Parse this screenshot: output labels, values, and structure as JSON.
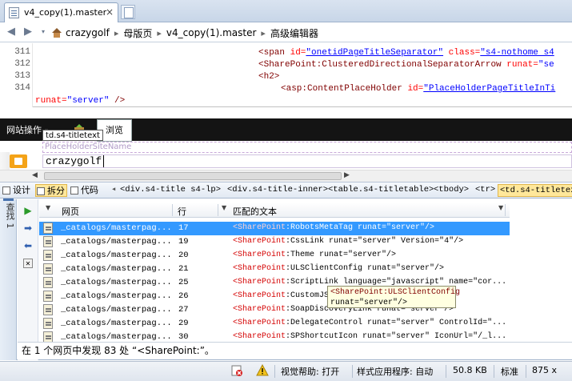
{
  "tab": {
    "label": "v4_copy(1).master",
    "close": "×"
  },
  "breadcrumb": {
    "items": [
      "crazygolf",
      "母版页",
      "v4_copy(1).master",
      "高级编辑器"
    ],
    "sep": "▸"
  },
  "code": {
    "line_numbers": [
      "311",
      "312",
      "313",
      "314"
    ],
    "lines": [
      [
        {
          "c": "tg",
          "t": "<span "
        },
        {
          "c": "at",
          "t": "id="
        },
        {
          "c": "vl",
          "t": "\"onetidPageTitleSeparator\""
        },
        {
          "c": "at",
          "t": " class="
        },
        {
          "c": "vl",
          "t": "\"s4-nothome s4"
        }
      ],
      [
        {
          "c": "tg",
          "t": "<SharePoint:ClusteredDirectionalSeparatorArrow "
        },
        {
          "c": "at",
          "t": "runat="
        },
        {
          "c": "pl",
          "t": "\"se"
        }
      ],
      [
        {
          "c": "tg",
          "t": "<h2>"
        }
      ],
      [
        {
          "c": "tg",
          "t": "<asp:ContentPlaceHolder "
        },
        {
          "c": "at",
          "t": "id="
        },
        {
          "c": "vl",
          "t": "\"PlaceHolderPageTitleInTi"
        }
      ],
      [
        {
          "c": "at",
          "t": "runat="
        },
        {
          "c": "pl",
          "t": "\"server\" "
        },
        {
          "c": "tg",
          "t": "/>"
        }
      ]
    ]
  },
  "design": {
    "site_actions": "网站操作",
    "browse": "浏览",
    "tag_tooltip": "td.s4-titletext",
    "placeholder_label": "PlaceHolderSiteName",
    "site_title": "crazygolf"
  },
  "viewbar": {
    "design": "设计",
    "split": "拆分",
    "code": "代码",
    "tags": [
      "<div.s4-title s4-lp>",
      "<div.s4-title-inner>",
      "<table.s4-titletable>",
      "<tbody>",
      "<tr>",
      "<td.s4-titletext"
    ]
  },
  "find": {
    "side_tab": "查找 1",
    "columns": [
      "网页",
      "行",
      "匹配的文本"
    ],
    "rows": [
      {
        "page": "_catalogs/masterpag...",
        "line": "17",
        "text": "RobotsMetaTag runat=\"server\"/>"
      },
      {
        "page": "_catalogs/masterpag...",
        "line": "19",
        "text": "CssLink runat=\"server\" Version=\"4\"/>"
      },
      {
        "page": "_catalogs/masterpag...",
        "line": "20",
        "text": "Theme runat=\"server\"/>"
      },
      {
        "page": "_catalogs/masterpag...",
        "line": "21",
        "text": "ULSClientConfig runat=\"server\"/>"
      },
      {
        "page": "_catalogs/masterpag...",
        "line": "25",
        "text": "ScriptLink language=\"javascript\" name=\"cor..."
      },
      {
        "page": "_catalogs/masterpag...",
        "line": "26",
        "text": "CustomJS"
      },
      {
        "page": "_catalogs/masterpag...",
        "line": "27",
        "text": "SoapDiscoveryLink runat=\"server\"/>"
      },
      {
        "page": "_catalogs/masterpag...",
        "line": "29",
        "text": "DelegateControl runat=\"server\" ControlId=\"..."
      },
      {
        "page": "_catalogs/masterpag...",
        "line": "30",
        "text": "SPShortcutIcon runat=\"server\" IconUrl=\"/_l..."
      }
    ],
    "match_prefix": "<SharePoint",
    "match_colon": ":",
    "tooltip_line1": "<SharePoint:ULSClientConfig",
    "tooltip_line2": "runat=\"server\"/>",
    "summary": "在 1 个网页中发现 83 处 “<SharePoint:”。"
  },
  "status": {
    "visual_help": "视觉帮助: 打开",
    "style_app": "样式应用程序: 自动",
    "size": "50.8 KB",
    "mode": "标准",
    "dimensions": "875 x"
  },
  "colors": {
    "selection": "#3399ff",
    "tag": "#800000",
    "attr": "#ff0000",
    "value": "#0000ff"
  }
}
